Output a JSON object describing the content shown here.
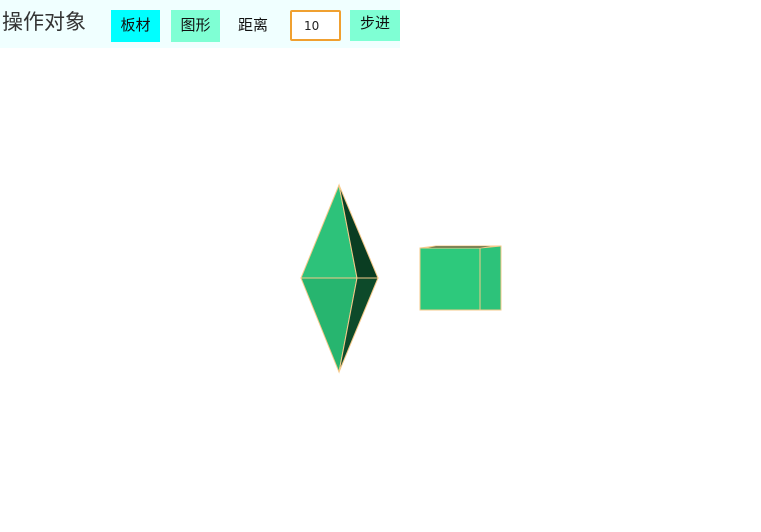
{
  "toolbar": {
    "title": "操作对象",
    "board_button_label": "板材",
    "shape_button_label": "图形",
    "distance_label": "距离",
    "distance_value": "10",
    "step_button_label": "步进"
  },
  "colors": {
    "toolbar_background": "#f0ffff",
    "board_button": "#00ffff",
    "shape_button": "#7fffd4",
    "step_button": "#7fffd4",
    "input_border": "#f0a030",
    "shape_face_light": "#2dc27a",
    "shape_face_mid": "#27b56f",
    "shape_face_dark": "#0a3d22",
    "shape_edge": "#f5c98a"
  },
  "scene": {
    "objects": [
      "octahedron",
      "cube"
    ]
  }
}
